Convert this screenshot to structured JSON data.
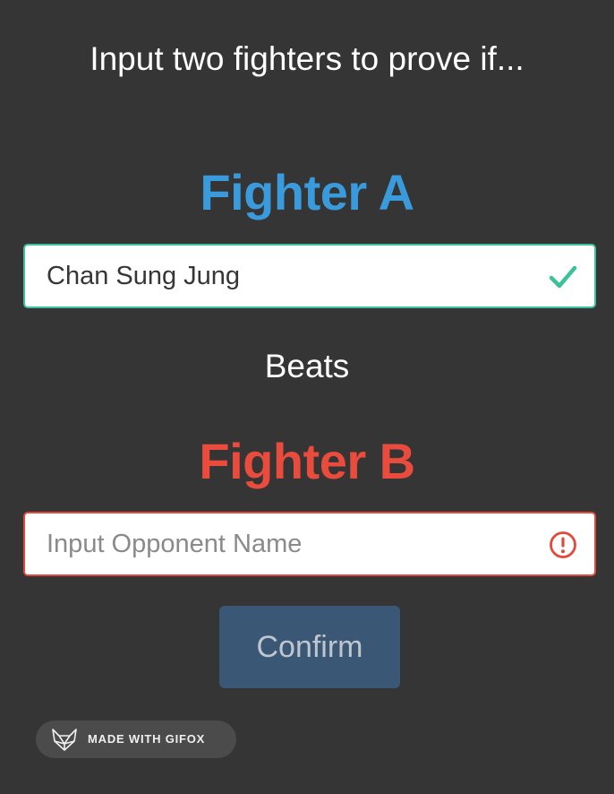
{
  "header": {
    "title": "Input two fighters to prove if..."
  },
  "fighter_a": {
    "title": "Fighter A",
    "input_value": "Chan Sung Jung",
    "placeholder": "",
    "status": "valid",
    "status_icon": "checkmark-icon",
    "title_color": "#3a9bdc",
    "border_color": "#3cc29a"
  },
  "relation": {
    "label": "Beats"
  },
  "fighter_b": {
    "title": "Fighter B",
    "input_value": "",
    "placeholder": "Input Opponent Name",
    "status": "error",
    "status_icon": "exclamation-circle-icon",
    "title_color": "#e94b3c",
    "border_color": "#e2493b"
  },
  "confirm": {
    "label": "Confirm",
    "color": "#3a5775"
  },
  "badge": {
    "label": "MADE WITH GIFOX",
    "icon": "fox-logo-icon"
  },
  "colors": {
    "background": "#353535"
  }
}
